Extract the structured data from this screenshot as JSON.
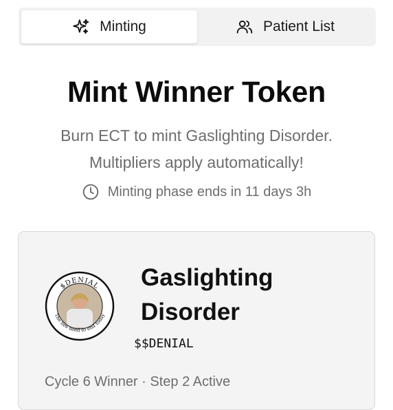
{
  "tabs": [
    {
      "label": "Minting",
      "icon": "sparkles-icon",
      "active": true
    },
    {
      "label": "Patient List",
      "icon": "users-icon",
      "active": false
    }
  ],
  "header": {
    "title": "Mint Winner Token",
    "subtitle_line1": "Burn ECT to mint Gaslighting Disorder.",
    "subtitle_line2": "Multipliers apply automatically!",
    "phase": "Minting phase ends in 11 days 3h",
    "phase_icon": "clock-icon"
  },
  "token": {
    "name_line1": "Gaslighting",
    "name_line2": "Disorder",
    "ticker": "$$DENIAL",
    "status": "Cycle 6 Winner · Step 2 Active",
    "logo_top_text": "$DENIAL",
    "logo_bottom_text": "The lies need to end today"
  },
  "colors": {
    "muted_text": "#6d6d6d",
    "card_bg": "#f4f4f4",
    "tab_bg": "#f2f2f2"
  }
}
